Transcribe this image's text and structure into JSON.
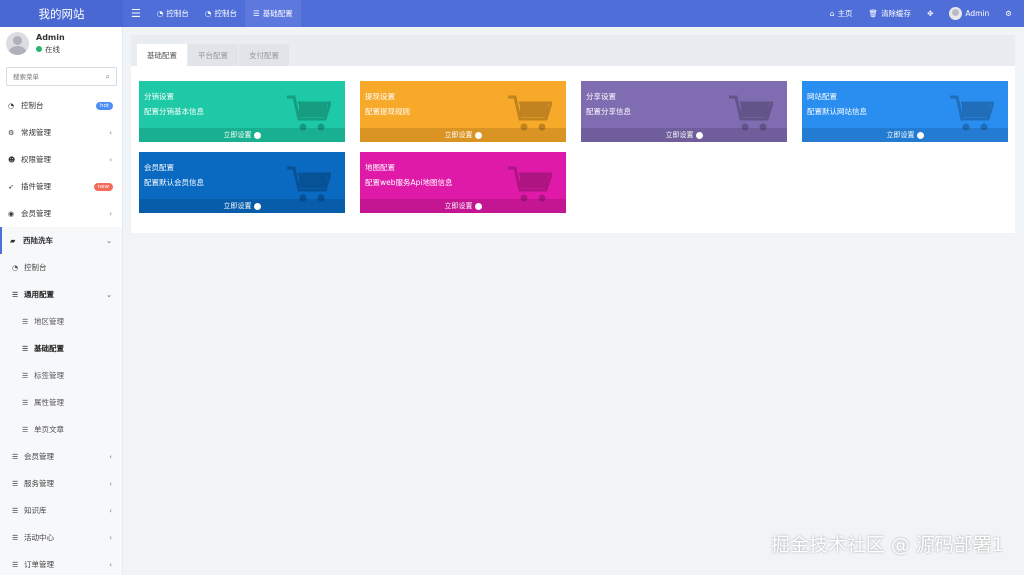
{
  "app": {
    "title": "我的网站"
  },
  "topnav": {
    "tabs": [
      {
        "label": "控制台",
        "icon": "dashboard-icon"
      },
      {
        "label": "控制台",
        "icon": "dashboard-icon"
      },
      {
        "label": "基础配置",
        "icon": "list-icon"
      }
    ],
    "right": {
      "home": "主页",
      "clear_cache": "清除缓存",
      "user": "Admin"
    }
  },
  "sidebar": {
    "user": {
      "name": "Admin",
      "status": "在线"
    },
    "search": {
      "placeholder": "搜索菜单"
    },
    "items": [
      {
        "label": "控制台",
        "icon": "dashboard-icon",
        "badge": "hot"
      },
      {
        "label": "常规管理",
        "icon": "cogs-icon"
      },
      {
        "label": "权限管理",
        "icon": "group-icon"
      },
      {
        "label": "插件管理",
        "icon": "rocket-icon",
        "badge": "new"
      },
      {
        "label": "会员管理",
        "icon": "user-circle-icon"
      },
      {
        "label": "西陆洗车",
        "icon": "folder-icon"
      }
    ],
    "sub": {
      "dashboard": "控制台",
      "general": "通用配置",
      "children": [
        "地区管理",
        "基础配置",
        "标签管理",
        "属性管理",
        "单页文章"
      ],
      "more": [
        "会员管理",
        "服务管理",
        "知识库",
        "活动中心",
        "订单管理"
      ]
    }
  },
  "content": {
    "tabs": [
      "基础配置",
      "平台配置",
      "支付配置"
    ],
    "cards": [
      {
        "title": "分销设置",
        "desc": "配置分销基本信息",
        "footer": "立即设置",
        "color": "#1dc9a6"
      },
      {
        "title": "提现设置",
        "desc": "配置提现规则",
        "footer": "立即设置",
        "color": "#f7a92a"
      },
      {
        "title": "分享设置",
        "desc": "配置分享信息",
        "footer": "立即设置",
        "color": "#7f6cb1"
      },
      {
        "title": "网站配置",
        "desc": "配置默认网站信息",
        "footer": "立即设置",
        "color": "#2a8ef0"
      },
      {
        "title": "会员配置",
        "desc": "配置默认会员信息",
        "footer": "立即设置",
        "color": "#0a6ac2"
      },
      {
        "title": "地图配置",
        "desc": "配置web服务Api地图信息",
        "footer": "立即设置",
        "color": "#e01aa8"
      }
    ]
  },
  "watermark": "掘金技术社区 @ 源码部署1"
}
